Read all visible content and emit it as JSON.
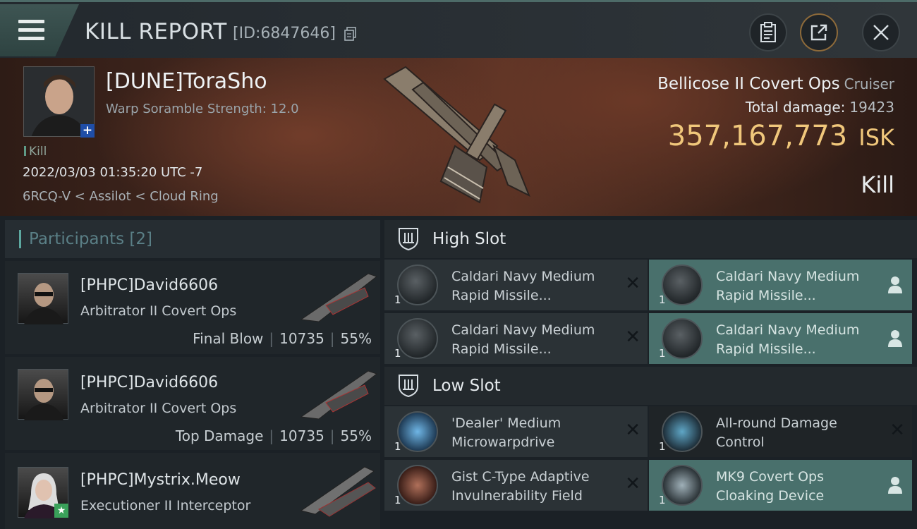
{
  "header": {
    "title": "KILL REPORT",
    "report_id": "[ID:6847646]"
  },
  "victim": {
    "name": "[DUNE]ToraSho",
    "warp_scramble": "Warp Soramble Strength: 12.0",
    "kill_tag": "Kill",
    "datetime": "2022/03/03 01:35:20 UTC -7",
    "location": "6RCQ-V < Assilot < Cloud Ring",
    "ship_name": "Bellicose II Covert Ops",
    "ship_class": "Cruiser",
    "total_damage_label": "Total damage:",
    "total_damage": "19423",
    "isk_value": "357,167,773",
    "isk_unit": "ISK",
    "result": "Kill"
  },
  "participants": {
    "header_label": "Participants",
    "count": "[2]",
    "rows": [
      {
        "name": "[PHPC]David6606",
        "ship": "Arbitrator II Covert Ops",
        "role": "Final Blow",
        "damage": "10735",
        "percent": "55%"
      },
      {
        "name": "[PHPC]David6606",
        "ship": "Arbitrator II Covert Ops",
        "role": "Top Damage",
        "damage": "10735",
        "percent": "55%"
      },
      {
        "name": "[PHPC]Mystrix.Meow",
        "ship": "Executioner II Interceptor"
      }
    ]
  },
  "slots": {
    "high": {
      "label": "High Slot",
      "modules": [
        {
          "name_line1": "Caldari Navy Medium",
          "name_line2": "Rapid Missile...",
          "qty": "1",
          "status": "destroyed"
        },
        {
          "name_line1": "Caldari Navy Medium",
          "name_line2": "Rapid Missile...",
          "qty": "1",
          "status": "dropped"
        },
        {
          "name_line1": "Caldari Navy Medium",
          "name_line2": "Rapid Missile...",
          "qty": "1",
          "status": "destroyed"
        },
        {
          "name_line1": "Caldari Navy Medium",
          "name_line2": "Rapid Missile...",
          "qty": "1",
          "status": "dropped"
        }
      ]
    },
    "low": {
      "label": "Low Slot",
      "modules": [
        {
          "name_line1": "'Dealer' Medium",
          "name_line2": "Microwarpdrive",
          "qty": "1",
          "status": "destroyed"
        },
        {
          "name_line1": "All-round Damage",
          "name_line2": "Control",
          "qty": "1",
          "status": "destroyed"
        },
        {
          "name_line1": "Gist C-Type Adaptive",
          "name_line2": "Invulnerability Field",
          "qty": "1",
          "status": "destroyed"
        },
        {
          "name_line1": "MK9 Covert Ops",
          "name_line2": "Cloaking Device",
          "qty": "1",
          "status": "dropped"
        }
      ]
    }
  },
  "icons": {
    "menu": "hamburger-icon",
    "copy": "copy-icon",
    "clipboard": "clipboard-icon",
    "share": "share-icon",
    "close": "close-icon",
    "slot": "shield-icon",
    "destroyed": "x-icon",
    "dropped": "person-icon"
  },
  "colors": {
    "accent_teal": "#5da8a0",
    "isk_gold": "#f0c77b",
    "fitted_bg": "#49706c"
  }
}
